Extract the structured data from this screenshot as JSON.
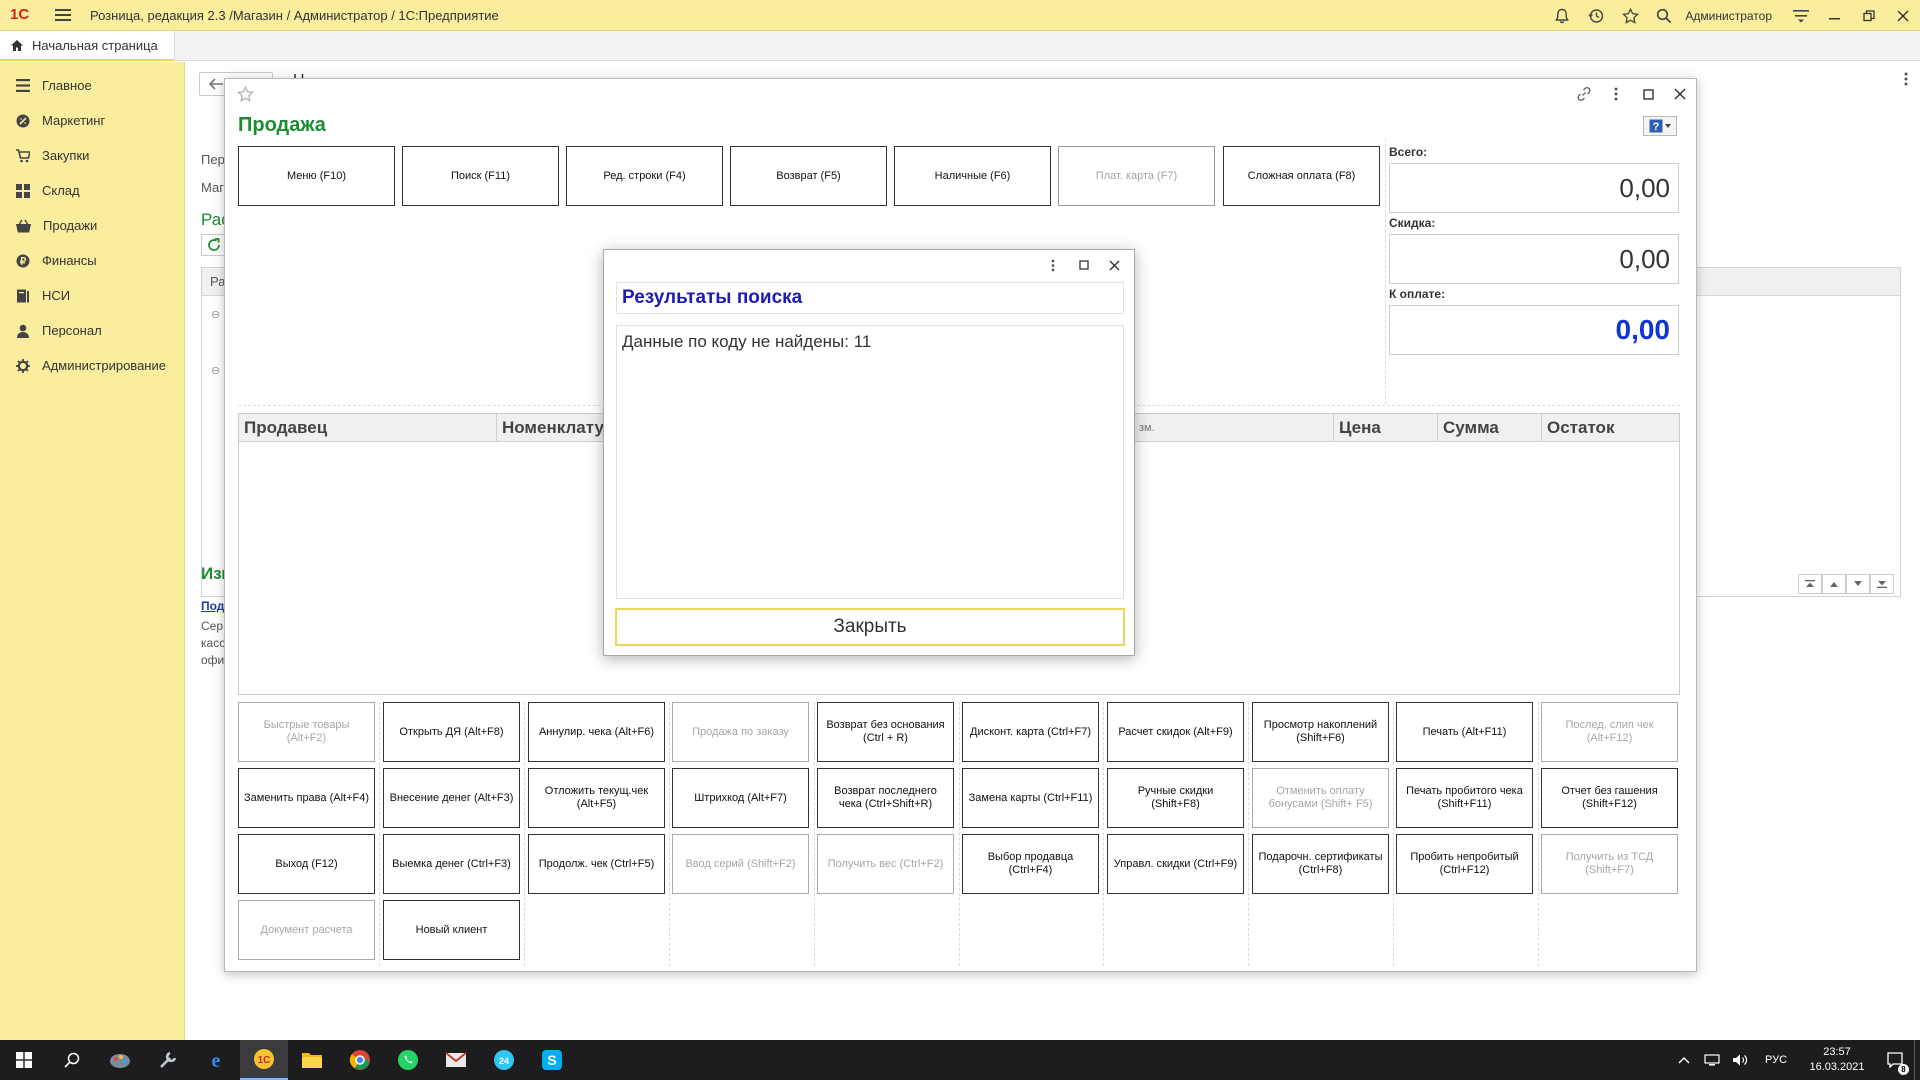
{
  "app": {
    "logo": "1С",
    "title": "Розница, редакция 2.3 /Магазин / Администратор / 1С:Предприятие",
    "user": "Администратор"
  },
  "tabs": {
    "home": "Начальная страница"
  },
  "sidebar": {
    "items": [
      {
        "label": "Главное",
        "icon": "list-icon"
      },
      {
        "label": "Маркетинг",
        "icon": "marketing-icon"
      },
      {
        "label": "Закупки",
        "icon": "purchases-icon"
      },
      {
        "label": "Склад",
        "icon": "warehouse-icon"
      },
      {
        "label": "Продажи",
        "icon": "basket-icon"
      },
      {
        "label": "Финансы",
        "icon": "finance-icon"
      },
      {
        "label": "НСИ",
        "icon": "book-icon"
      },
      {
        "label": "Персонал",
        "icon": "person-icon"
      },
      {
        "label": "Администрирование",
        "icon": "gear-icon"
      }
    ]
  },
  "background_page": {
    "title_fragment": "Н",
    "row1": "Пер",
    "row2": "Маг",
    "section1": "Рас",
    "col_head": "Ра",
    "section2": "Изм",
    "link": "Под",
    "text1": "Сер",
    "text2": "касс",
    "text3": "офи"
  },
  "sale": {
    "title": "Продажа",
    "fkeys": [
      {
        "label": "Меню (F10)",
        "enabled": true
      },
      {
        "label": "Поиск (F11)",
        "enabled": true
      },
      {
        "label": "Ред. строки (F4)",
        "enabled": true
      },
      {
        "label": "Возврат (F5)",
        "enabled": true
      },
      {
        "label": "Наличные (F6)",
        "enabled": true
      },
      {
        "label": "Плат. карта (F7)",
        "enabled": false
      },
      {
        "label": "Сложная оплата (F8)",
        "enabled": true
      }
    ],
    "totals": {
      "total_label": "Всего:",
      "total_value": "0,00",
      "discount_label": "Скидка:",
      "discount_value": "0,00",
      "pay_label": "К оплате:",
      "pay_value": "0,00"
    },
    "grid_columns": [
      "Продавец",
      "Номенклату",
      "зм.",
      "Цена",
      "Сумма",
      "Остаток"
    ],
    "buttons": [
      [
        {
          "label": "Быстрые товары (Alt+F2)",
          "enabled": false
        },
        {
          "label": "Открыть ДЯ (Alt+F8)",
          "enabled": true
        },
        {
          "label": "Аннулир. чека (Alt+F6)",
          "enabled": true
        },
        {
          "label": "Продажа по заказу",
          "enabled": false
        },
        {
          "label": "Возврат без основания (Ctrl + R)",
          "enabled": true
        },
        {
          "label": "Дисконт. карта (Ctrl+F7)",
          "enabled": true
        },
        {
          "label": "Расчет скидок (Alt+F9)",
          "enabled": true
        },
        {
          "label": "Просмотр накоплений (Shift+F6)",
          "enabled": true
        },
        {
          "label": "Печать (Alt+F11)",
          "enabled": true
        },
        {
          "label": "Послед. слип чек (Alt+F12)",
          "enabled": false
        }
      ],
      [
        {
          "label": "Заменить права (Alt+F4)",
          "enabled": true
        },
        {
          "label": "Внесение денег (Alt+F3)",
          "enabled": true
        },
        {
          "label": "Отложить текущ.чек (Alt+F5)",
          "enabled": true
        },
        {
          "label": "Штрихкод (Alt+F7)",
          "enabled": true
        },
        {
          "label": "Возврат последнего чека (Ctrl+Shift+R)",
          "enabled": true
        },
        {
          "label": "Замена карты (Ctrl+F11)",
          "enabled": true
        },
        {
          "label": "Ручные скидки (Shift+F8)",
          "enabled": true
        },
        {
          "label": "Отменить оплату бонусами (Shift+ F5)",
          "enabled": false
        },
        {
          "label": "Печать пробитого чека (Shift+F11)",
          "enabled": true
        },
        {
          "label": "Отчет без гашения (Shift+F12)",
          "enabled": true
        }
      ],
      [
        {
          "label": "Выход (F12)",
          "enabled": true
        },
        {
          "label": "Выемка денег (Ctrl+F3)",
          "enabled": true
        },
        {
          "label": "Продолж. чек (Ctrl+F5)",
          "enabled": true
        },
        {
          "label": "Ввод серий (Shift+F2)",
          "enabled": false
        },
        {
          "label": "Получить вес (Ctrl+F2)",
          "enabled": false
        },
        {
          "label": "Выбор продавца (Ctrl+F4)",
          "enabled": true
        },
        {
          "label": "Управл. скидки (Ctrl+F9)",
          "enabled": true
        },
        {
          "label": "Подарочн. сертификаты (Ctrl+F8)",
          "enabled": true
        },
        {
          "label": "Пробить непробитый (Ctrl+F12)",
          "enabled": true
        },
        {
          "label": "Получить из ТСД (Shift+F7)",
          "enabled": false
        }
      ],
      [
        {
          "label": "Документ расчета",
          "enabled": false
        },
        {
          "label": "Новый клиент",
          "enabled": true
        }
      ]
    ]
  },
  "dialog": {
    "title": "Результаты поиска",
    "message": "Данные по коду не найдены: 11",
    "close_label": "Закрыть"
  },
  "taskbar": {
    "lang": "РУС",
    "time": "23:57",
    "date": "16.03.2021",
    "notifications": "8"
  },
  "colors": {
    "panel_yellow": "#fbed9e",
    "title_green": "#1a8c32",
    "dialog_title_blue": "#1c1cb6",
    "pay_blue": "#1034d6",
    "focus_yellow": "#f1d35c"
  }
}
